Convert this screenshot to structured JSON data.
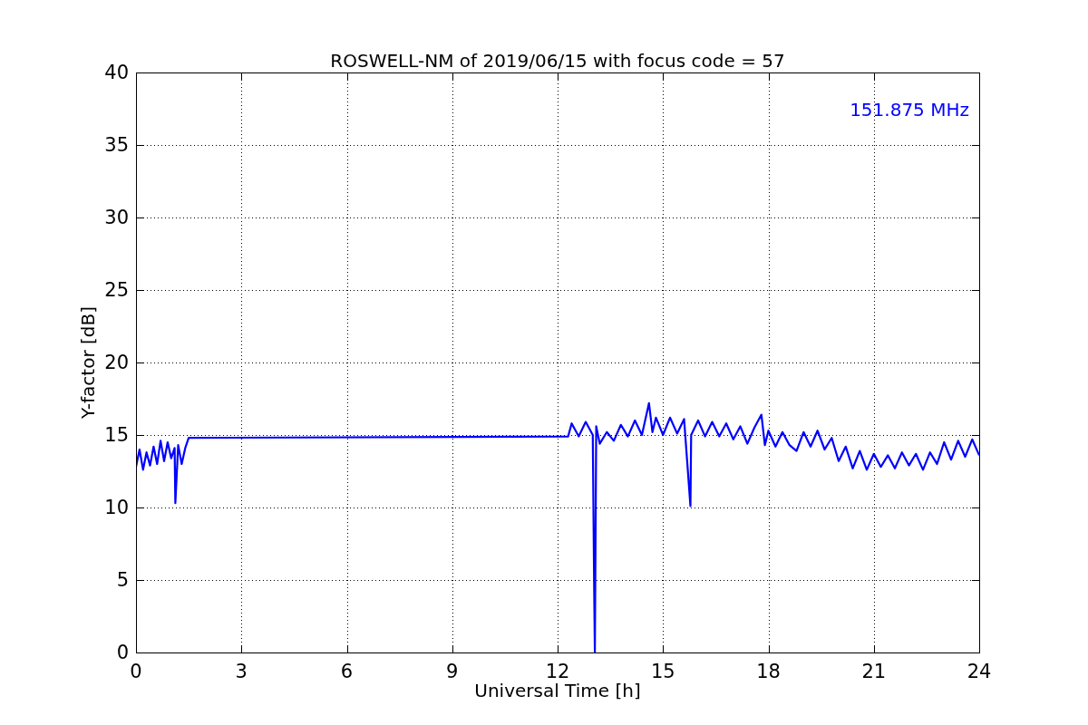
{
  "figure": {
    "chart_data": {
      "type": "line",
      "title": "ROSWELL-NM of 2019/06/15 with focus code = 57",
      "xlabel": "Universal Time [h]",
      "ylabel": "Y-factor [dB]",
      "xlim": [
        0,
        24
      ],
      "ylim": [
        0,
        40
      ],
      "xticks": [
        0,
        3,
        6,
        9,
        12,
        15,
        18,
        21,
        24
      ],
      "yticks": [
        0,
        5,
        10,
        15,
        20,
        25,
        30,
        35,
        40
      ],
      "grid": true,
      "series": [
        {
          "name": "151.875 MHz",
          "color": "#0000ff",
          "x": [
            0,
            0.1,
            0.2,
            0.3,
            0.4,
            0.5,
            0.6,
            0.7,
            0.8,
            0.9,
            1.0,
            1.1,
            1.12,
            1.2,
            1.3,
            1.4,
            1.5,
            12.3,
            12.4,
            12.6,
            12.8,
            13.0,
            13.04,
            13.06,
            13.1,
            13.2,
            13.4,
            13.6,
            13.8,
            14.0,
            14.2,
            14.4,
            14.6,
            14.7,
            14.8,
            15.0,
            15.2,
            15.4,
            15.6,
            15.78,
            15.8,
            16.0,
            16.2,
            16.4,
            16.6,
            16.8,
            17.0,
            17.2,
            17.4,
            17.6,
            17.8,
            17.9,
            18.0,
            18.2,
            18.4,
            18.6,
            18.8,
            19.0,
            19.2,
            19.4,
            19.6,
            19.8,
            20.0,
            20.2,
            20.4,
            20.6,
            20.8,
            21.0,
            21.2,
            21.4,
            21.6,
            21.8,
            22.0,
            22.2,
            22.4,
            22.6,
            22.8,
            23.0,
            23.2,
            23.4,
            23.6,
            23.8,
            24.0
          ],
          "values": [
            12.8,
            14.0,
            12.6,
            13.8,
            12.9,
            14.2,
            13.0,
            14.6,
            13.2,
            14.5,
            13.4,
            14.1,
            10.3,
            14.3,
            13.0,
            14.1,
            14.8,
            14.9,
            15.8,
            14.9,
            15.9,
            15.0,
            4.6,
            0,
            15.6,
            14.4,
            15.2,
            14.6,
            15.7,
            14.9,
            16.0,
            15.0,
            17.2,
            15.2,
            16.2,
            15.0,
            16.2,
            15.1,
            16.1,
            10.1,
            15.0,
            16.0,
            14.9,
            15.9,
            14.9,
            15.8,
            14.7,
            15.6,
            14.4,
            15.5,
            16.4,
            14.3,
            15.3,
            14.2,
            15.2,
            14.3,
            13.9,
            15.2,
            14.2,
            15.3,
            14.0,
            14.8,
            13.2,
            14.2,
            12.7,
            13.9,
            12.6,
            13.7,
            12.8,
            13.6,
            12.7,
            13.8,
            12.9,
            13.7,
            12.6,
            13.8,
            13.0,
            14.5,
            13.3,
            14.6,
            13.5,
            14.7,
            13.6
          ]
        }
      ]
    }
  }
}
